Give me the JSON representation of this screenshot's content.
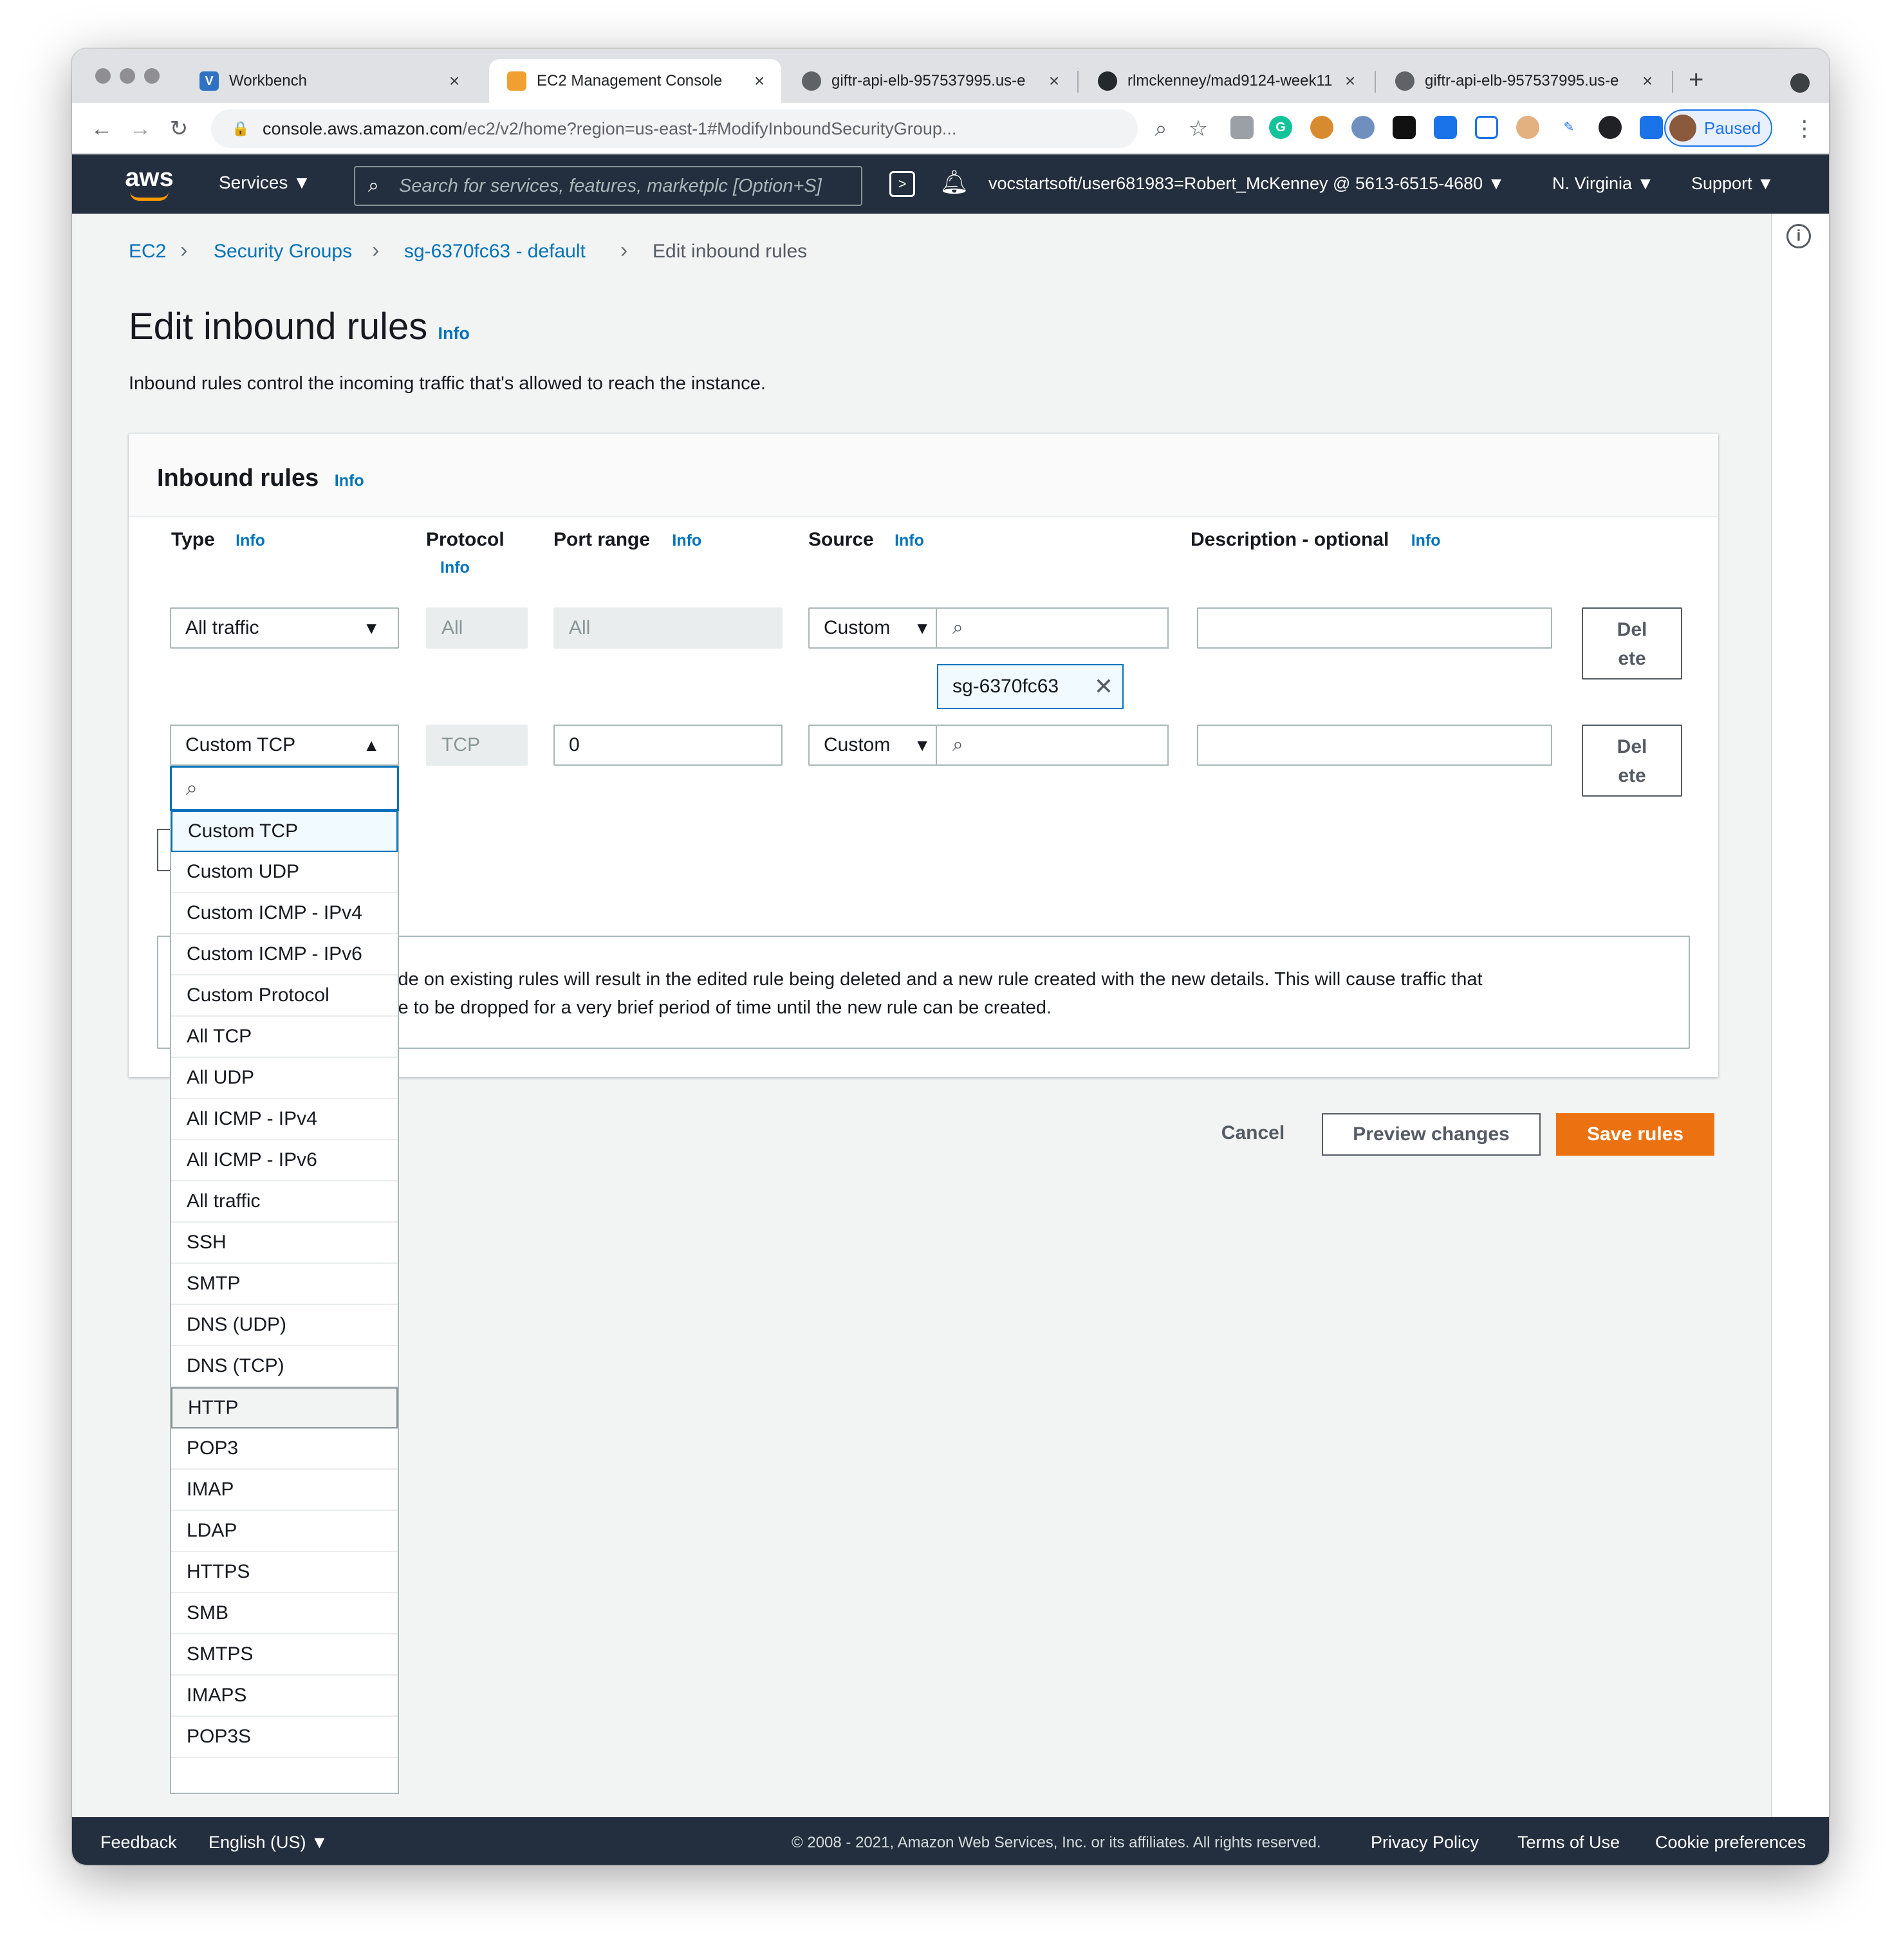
{
  "browser": {
    "tabs": [
      {
        "label": "Workbench",
        "icon": "canvas-v-icon"
      },
      {
        "label": "EC2 Management Console",
        "icon": "aws-cube-icon"
      },
      {
        "label": "giftr-api-elb-957537995.us-e",
        "icon": "globe-icon"
      },
      {
        "label": "rlmckenney/mad9124-week11",
        "icon": "github-icon"
      },
      {
        "label": "giftr-api-elb-957537995.us-e",
        "icon": "globe-icon"
      }
    ],
    "new_tab": "+",
    "url_host": "console.aws.amazon.com",
    "url_path": "/ec2/v2/home?region=us-east-1#ModifyInboundSecurityGroup...",
    "profile_status": "Paused"
  },
  "aws_nav": {
    "logo": "aws",
    "services": "Services ▼",
    "search_placeholder": "Search for services, features, marketplc [Option+S]",
    "account": "vocstartsoft/user681983=Robert_McKenney @ 5613-6515-4680 ▼",
    "region": "N. Virginia ▼",
    "support": "Support ▼"
  },
  "breadcrumb": [
    "EC2",
    "Security Groups",
    "sg-6370fc63 - default",
    "Edit inbound rules"
  ],
  "page": {
    "title": "Edit inbound rules",
    "title_info": "Info",
    "description": "Inbound rules control the incoming traffic that's allowed to reach the instance."
  },
  "panel": {
    "title": "Inbound rules",
    "info": "Info",
    "columns": {
      "type": "Type",
      "protocol": "Protocol",
      "port_range": "Port range",
      "source": "Source",
      "description": "Description - optional",
      "info": "Info"
    },
    "rows": [
      {
        "type": "All traffic",
        "protocol": "All",
        "port": "All",
        "source": "Custom",
        "source_token": "sg-6370fc63",
        "delete": [
          "Del",
          "ete"
        ]
      },
      {
        "type": "Custom TCP",
        "protocol": "TCP",
        "port": "0",
        "source": "Custom",
        "delete": [
          "Del",
          "ete"
        ]
      }
    ],
    "warning_line1": "ide on existing rules will result in the edited rule being deleted and a new rule created with the new details. This will cause traffic that",
    "warning_line2": "le to be dropped for a very brief period of time until the new rule can be created."
  },
  "dropdown": {
    "options": [
      "Custom TCP",
      "Custom UDP",
      "Custom ICMP - IPv4",
      "Custom ICMP - IPv6",
      "Custom Protocol",
      "All TCP",
      "All UDP",
      "All ICMP - IPv4",
      "All ICMP - IPv6",
      "All traffic",
      "SSH",
      "SMTP",
      "DNS (UDP)",
      "DNS (TCP)",
      "HTTP",
      "POP3",
      "IMAP",
      "LDAP",
      "HTTPS",
      "SMB",
      "SMTPS",
      "IMAPS",
      "POP3S"
    ],
    "selected": "Custom TCP",
    "hovered": "HTTP"
  },
  "actions": {
    "cancel": "Cancel",
    "preview": "Preview changes",
    "save": "Save rules"
  },
  "footer": {
    "feedback": "Feedback",
    "language": "English (US) ▼",
    "copyright": "© 2008 - 2021, Amazon Web Services, Inc. or its affiliates. All rights reserved.",
    "privacy": "Privacy Policy",
    "terms": "Terms of Use",
    "cookies": "Cookie preferences"
  },
  "colors": {
    "aws_nav": "#232f3e",
    "link": "#0073bb",
    "save": "#ec7211"
  }
}
